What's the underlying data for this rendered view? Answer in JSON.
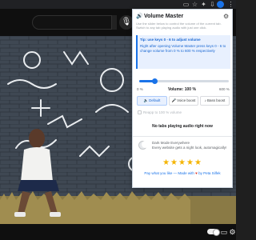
{
  "browser": {
    "avatar_color": "#1a73e8",
    "icons": [
      "cast-icon",
      "star-icon",
      "puzzle-icon",
      "download-icon",
      "more-icon"
    ]
  },
  "youtube": {
    "mic_icon": "microphone-icon"
  },
  "popup": {
    "title": "Volume Master",
    "description": "Use the slider below to control the volume of the current tab. Switch to any tab playing audio with just one click.",
    "tip": {
      "title": "Tip: use keys 0 - 6 to adjust volume",
      "text": "Right after opening Volume Master press keys 0 - 6 to change volume from 0 % to 600 % respectively"
    },
    "slider": {
      "min_label": "0 %",
      "max_label": "600 %",
      "volume_label": "Volume: 100 %",
      "value_percent": 100,
      "max_percent": 600,
      "accent": "#1a73e8"
    },
    "modes": [
      {
        "label": "Default",
        "icon": "speaker-icon",
        "active": true
      },
      {
        "label": "Voice boost",
        "icon": "mic-icon",
        "active": false
      },
      {
        "label": "Bass boost",
        "icon": "note-icon",
        "active": false
      }
    ],
    "bass_note": "Reapp to 100 % volume",
    "no_tabs": "No tabs playing audio right now",
    "dark_mode": {
      "title": "Dark Mode Everywhere",
      "subtitle": "Every website gets a night look, automagically!"
    },
    "stars": "★★★★★",
    "credit": {
      "prefix": "Pay what you like — Made with ",
      "heart": "♥",
      "suffix": " by Peta Silfek"
    }
  }
}
